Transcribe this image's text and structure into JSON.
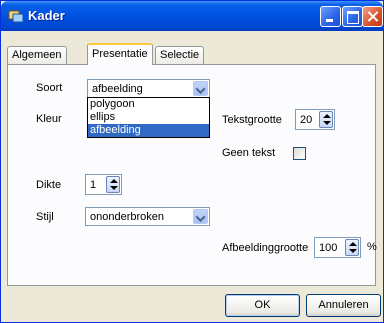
{
  "window": {
    "title": "Kader"
  },
  "tabs": [
    {
      "label": "Algemeen"
    },
    {
      "label": "Presentatie"
    },
    {
      "label": "Selectie"
    }
  ],
  "form": {
    "soort_label": "Soort",
    "soort_value": "afbeelding",
    "soort_options": [
      "polygoon",
      "ellips",
      "afbeelding"
    ],
    "kleur_label": "Kleur",
    "tekstgrootte_label": "Tekstgrootte",
    "tekstgrootte_value": "20",
    "geen_tekst_label": "Geen tekst",
    "geen_tekst_checked": false,
    "dikte_label": "Dikte",
    "dikte_value": "1",
    "stijl_label": "Stijl",
    "stijl_value": "ononderbroken",
    "afbeeldinggrootte_label": "Afbeeldinggrootte",
    "afbeeldinggrootte_value": "100",
    "afbeeldinggrootte_unit": "%"
  },
  "buttons": {
    "ok": "OK",
    "cancel": "Annuleren"
  },
  "colors": {
    "titlebar": "#0055e5",
    "selection": "#316ac5",
    "dialog_bg": "#ece9d8"
  }
}
